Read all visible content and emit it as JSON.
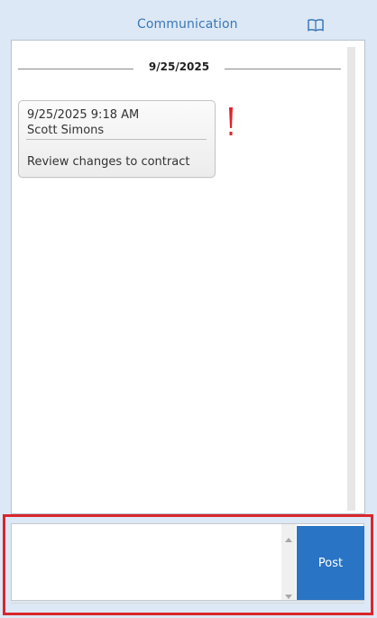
{
  "header": {
    "title": "Communication",
    "help_icon": "book-icon"
  },
  "thread": {
    "date_separator": "9/25/2025",
    "messages": [
      {
        "timestamp": "9/25/2025 9:18 AM",
        "author": "Scott Simons",
        "text": "Review changes to contract",
        "flag_icon": "exclamation-alert-icon",
        "flag_color": "#e0242a"
      }
    ]
  },
  "composer": {
    "input_value": "",
    "post_label": "Post",
    "highlight_color": "#d9262c",
    "post_color": "#2a74c5"
  },
  "theme": {
    "accent": "#3a78b8",
    "background": "#dce8f5"
  }
}
